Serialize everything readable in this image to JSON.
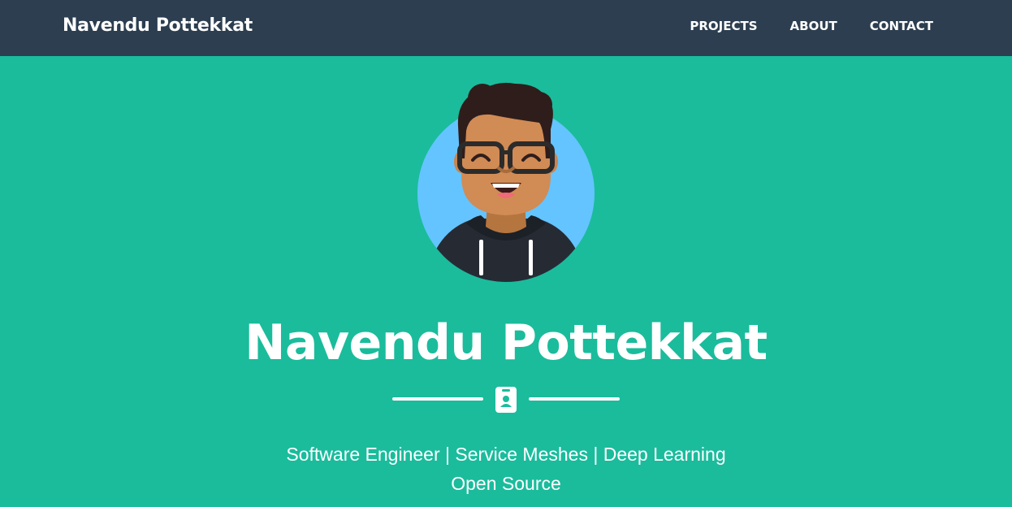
{
  "navbar": {
    "brand": "Navendu Pottekkat",
    "links": [
      {
        "label": "PROJECTS"
      },
      {
        "label": "ABOUT"
      },
      {
        "label": "CONTACT"
      }
    ]
  },
  "masthead": {
    "title": "Navendu Pottekkat",
    "subtitle_line1": "Software Engineer | Service Meshes | Deep Learning",
    "subtitle_line2": "Open Source",
    "divider_icon": "id-badge-icon",
    "avatar_icon": "cartoon-avatar-icon"
  },
  "colors": {
    "navbar_bg": "#2c3e50",
    "masthead_bg": "#1abc9c",
    "avatar_circle": "#64c4ff",
    "text": "#ffffff"
  }
}
